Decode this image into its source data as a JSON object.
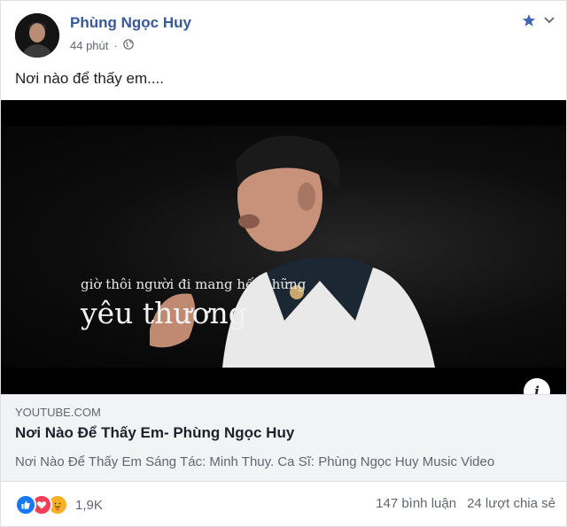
{
  "post": {
    "author": "Phùng Ngọc Huy",
    "time": "44 phút",
    "separator": "·",
    "text": "Nơi nào để thấy em...."
  },
  "video": {
    "caption_line1": "giờ thôi người đi mang hết những",
    "caption_line2": "yêu thương"
  },
  "link_preview": {
    "domain": "YOUTUBE.COM",
    "title": "Nơi Nào Để Thấy Em- Phùng Ngọc Huy",
    "description": "Nơi Nào Để Thấy Em Sáng Tác: Minh Thuy. Ca Sĩ: Phùng Ngọc Huy Music Video"
  },
  "footer": {
    "reaction_count": "1,9K",
    "comments": "147 bình luận",
    "shares": "24 lượt chia sẻ"
  },
  "colors": {
    "author_link": "#385898",
    "like": "#1877f2",
    "love": "#f33e58",
    "care": "#f7b125"
  },
  "icons": [
    "avatar",
    "globe-icon",
    "star-icon",
    "chevron-down-icon",
    "info-icon",
    "like-reaction-icon",
    "love-reaction-icon",
    "care-reaction-icon"
  ]
}
